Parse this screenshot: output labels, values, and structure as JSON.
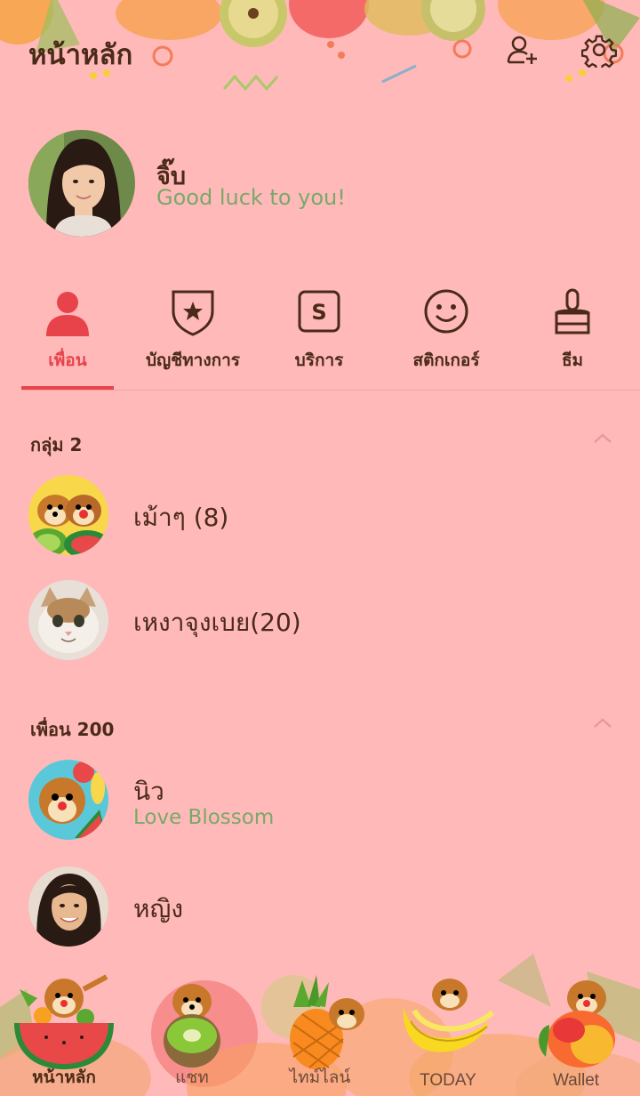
{
  "header": {
    "title": "หน้าหลัก",
    "add_friend_icon": "add-friend-icon",
    "settings_icon": "gear-icon"
  },
  "profile": {
    "name": "จิ๊บ",
    "status": "Good luck to you!"
  },
  "tabs": [
    {
      "label": "เพื่อน",
      "icon": "person-icon",
      "active": true
    },
    {
      "label": "บัญชีทางการ",
      "icon": "shield-star-icon",
      "active": false
    },
    {
      "label": "บริการ",
      "icon": "service-s-icon",
      "active": false
    },
    {
      "label": "สติกเกอร์",
      "icon": "smiley-icon",
      "active": false
    },
    {
      "label": "ธีม",
      "icon": "brush-icon",
      "active": false
    }
  ],
  "groups": {
    "header": "กลุ่ม 2",
    "items": [
      {
        "name": "เม้าๆ (8)"
      },
      {
        "name": "เหงาจุงเบย(20)"
      }
    ]
  },
  "friends": {
    "header": "เพื่อน 200",
    "items": [
      {
        "name": "นิว",
        "status": "Love Blossom"
      },
      {
        "name": "หญิง",
        "status": ""
      }
    ]
  },
  "bottom_nav": [
    {
      "label": "หน้าหลัก",
      "icon": "watermelon-chipmunk-icon",
      "active": true
    },
    {
      "label": "แชท",
      "icon": "kiwi-chipmunk-icon",
      "active": false
    },
    {
      "label": "ไทม์ไลน์",
      "icon": "pineapple-chipmunk-icon",
      "active": false
    },
    {
      "label": "TODAY",
      "icon": "banana-chipmunk-icon",
      "active": false
    },
    {
      "label": "Wallet",
      "icon": "mango-chipmunk-icon",
      "active": false
    }
  ],
  "colors": {
    "background": "#ffb9b9",
    "accent": "#e8434b",
    "text": "#4a2a18",
    "status": "#7aa86a"
  }
}
